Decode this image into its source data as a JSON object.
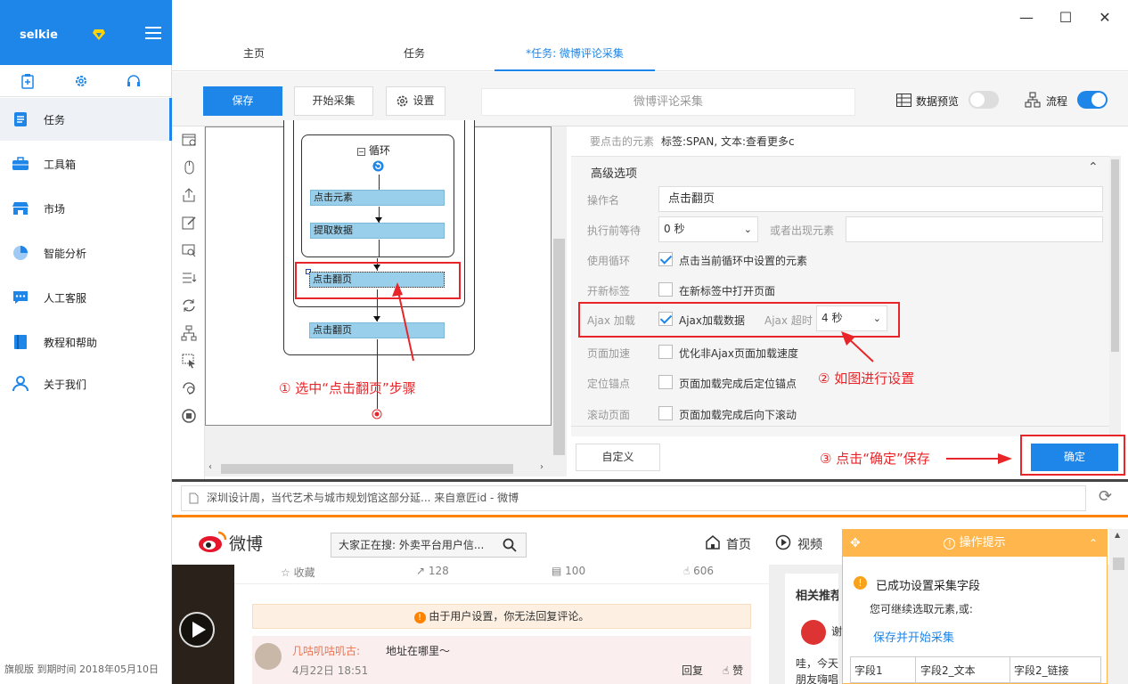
{
  "sidebar": {
    "username": "selkie",
    "nav": [
      {
        "label": "任务",
        "icon": "task-icon"
      },
      {
        "label": "工具箱",
        "icon": "toolbox-icon"
      },
      {
        "label": "市场",
        "icon": "market-icon"
      },
      {
        "label": "智能分析",
        "icon": "pie-chart-icon"
      },
      {
        "label": "人工客服",
        "icon": "chat-icon"
      },
      {
        "label": "教程和帮助",
        "icon": "book-icon"
      },
      {
        "label": "关于我们",
        "icon": "user-icon"
      }
    ],
    "footer": "旗舰版  到期时间  2018年05月10日"
  },
  "tabs": [
    {
      "label": "主页"
    },
    {
      "label": "任务"
    },
    {
      "label": "*任务: 微博评论采集"
    }
  ],
  "toolbar": {
    "save_label": "保存",
    "start_label": "开始采集",
    "settings_label": "设置",
    "task_title": "微博评论采集",
    "data_preview_label": "数据预览",
    "flow_label": "流程"
  },
  "flow": {
    "loop_label": "循环",
    "steps": [
      "点击元素",
      "提取数据",
      "点击翻页",
      "点击翻页"
    ]
  },
  "annotations": {
    "a1": "① 选中“点击翻页”步骤",
    "a2": "② 如图进行设置",
    "a3": "③ 点击“确定”保存"
  },
  "props": {
    "target_label": "要点击的元素",
    "target_value": "标签:SPAN, 文本:查看更多c",
    "advanced_header": "高级选项",
    "op_name_label": "操作名",
    "op_name_value": "点击翻页",
    "wait_label": "执行前等待",
    "wait_value": "0 秒",
    "or_appear_label": "或者出现元素",
    "use_loop_label": "使用循环",
    "use_loop_text": "点击当前循环中设置的元素",
    "new_tab_label": "开新标签",
    "new_tab_text": "在新标签中打开页面",
    "ajax_label": "Ajax 加载",
    "ajax_text": "Ajax加载数据",
    "ajax_timeout_label": "Ajax 超时",
    "ajax_timeout_value": "4 秒",
    "speed_label": "页面加速",
    "speed_text": "优化非Ajax页面加载速度",
    "anchor_label": "定位锚点",
    "anchor_text": "页面加载完成后定位锚点",
    "scroll_label": "滚动页面",
    "scroll_text": "页面加载完成后向下滚动",
    "custom_label": "自定义",
    "ok_label": "确定"
  },
  "browser": {
    "url": "深圳设计周，当代艺术与城市规划馆这部分延... 来自意匠id - 微博",
    "weibo_logo": "微博",
    "search_text": "大家正在搜: 外卖平台用户信...",
    "nav_home": "首页",
    "nav_video": "视频",
    "fav": "收藏",
    "repost": "128",
    "comments": "100",
    "likes": "606",
    "notice": "由于用户设置，你无法回复评论。",
    "commenter": "几咕叽咕叽古:",
    "comment_text": "地址在哪里～",
    "comment_time": "4月22日 18:51",
    "reply": "回复",
    "like": "赞",
    "related": "相关推荐",
    "rel_snip1": "谢",
    "rel_snip2": "哇，今天",
    "rel_snip3": "朋友嗨唱"
  },
  "tip": {
    "header": "操作提示",
    "msg": "已成功设置采集字段",
    "sub": "您可继续选取元素,或:",
    "link": "保存并开始采集",
    "cols": [
      "字段1",
      "字段2_文本",
      "字段2_链接"
    ]
  },
  "colors": {
    "primary": "#1e86e8",
    "annotation": "#e8262a",
    "weibo_orange": "#ff8200",
    "tip": "#ffb74d"
  }
}
